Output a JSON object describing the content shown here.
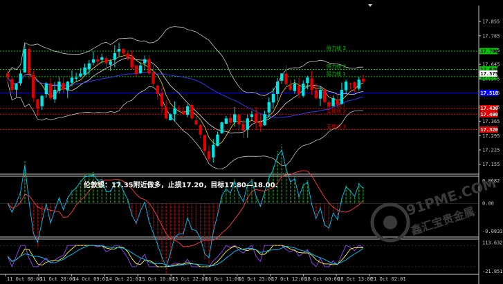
{
  "panels": {
    "main": {
      "ylim": [
        17.12,
        17.92
      ],
      "price_labels": [
        "17.855",
        "17.785",
        "17.715",
        "17.645",
        "17.575",
        "17.505",
        "17.435",
        "17.365",
        "17.295",
        "17.225",
        "17.155"
      ]
    },
    "macd": {
      "ylim": [
        -0.095,
        0.075
      ],
      "labels": [
        "0.0682",
        "0.00",
        "-0.0833"
      ]
    },
    "osc": {
      "ylim": [
        -26,
        120
      ],
      "labels": [
        "113.6327",
        "-21.8519"
      ]
    }
  },
  "time_labels": [
    "11 Oct 08:00",
    "11 Oct 20:00",
    "14 Oct 09:01",
    "14 Oct 21:01",
    "15 Oct 10:00",
    "15 Oct 22:00",
    "16 Oct 11:00",
    "16 Oct 23:00",
    "17 Oct 12:00",
    "18 Oct 00:00",
    "18 Oct 13:00",
    "21 Oct 02:01"
  ],
  "levels": [
    {
      "label": "阻力线 3",
      "price": 17.71,
      "color": "#00c800",
      "tag": "17.700",
      "tag_bg": "#00c800",
      "tag_fg": "#000000"
    },
    {
      "label": "阻力线 2",
      "price": 17.62,
      "color": "#00c800",
      "tag": "17.620",
      "tag_bg": "#00c800",
      "tag_fg": "#000000"
    },
    {
      "label": "阻力线 1",
      "price": 17.585,
      "color": "#00c800",
      "tag": "17.570",
      "tag_bg": "#00c800",
      "tag_fg": "#000000"
    },
    {
      "label": "支撑线 1",
      "price": 17.43,
      "color": "#e00000",
      "tag": "17.430",
      "tag_bg": "#e00000",
      "tag_fg": "#ffffff"
    },
    {
      "label": "支撑线 2",
      "price": 17.4,
      "color": "#e00000",
      "tag": "17.400",
      "tag_bg": "#e00000",
      "tag_fg": "#ffffff"
    },
    {
      "label": "支撑线 3",
      "price": 17.325,
      "color": "#e00000",
      "tag": "17.320",
      "tag_bg": "#e00000",
      "tag_fg": "#ffffff"
    }
  ],
  "blue_level": {
    "price": 17.505,
    "tag": "17.510",
    "tag_bg": "#0000ff",
    "tag_fg": "#ffffff",
    "color": "#0000ff"
  },
  "current_price": {
    "tag": "17.575",
    "tag_bg": "#ffffff",
    "tag_fg": "#000000"
  },
  "annotation": "伦敦银：17.35附近做多，止损17.20，目标17.80—18.00.",
  "watermark": {
    "text_top": "91PME.COM",
    "text_bottom": "鑫汇宝贵金属"
  },
  "colors": {
    "bull_candle": "#00e6e6",
    "bear_candle": "#e00000",
    "bands": "#c8c8c8",
    "ma_fast": "#ffd21e",
    "ma_mid": "#e0e0e0",
    "ma_slow": "#3c3cff",
    "macd_pos": "#00c800",
    "macd_neg": "#e00000",
    "signal_line": "#ff4040",
    "macd_line": "#00c8ff",
    "osc_1": "#ffff40",
    "osc_2": "#9a46ff",
    "osc_3": "#00c8ff",
    "grid": "#ffffff"
  },
  "chart_data": {
    "type": "candlestick",
    "close": [
      17.58,
      17.52,
      17.55,
      17.6,
      17.72,
      17.6,
      17.48,
      17.43,
      17.49,
      17.55,
      17.48,
      17.52,
      17.56,
      17.52,
      17.56,
      17.58,
      17.58,
      17.6,
      17.63,
      17.65,
      17.67,
      17.66,
      17.68,
      17.65,
      17.66,
      17.7,
      17.72,
      17.7,
      17.68,
      17.63,
      17.6,
      17.64,
      17.67,
      17.6,
      17.55,
      17.5,
      17.44,
      17.38,
      17.4,
      17.43,
      17.42,
      17.4,
      17.44,
      17.38,
      17.35,
      17.3,
      17.22,
      17.18,
      17.25,
      17.3,
      17.36,
      17.38,
      17.36,
      17.4,
      17.35,
      17.32,
      17.38,
      17.4,
      17.36,
      17.34,
      17.4,
      17.46,
      17.5,
      17.56,
      17.6,
      17.55,
      17.52,
      17.55,
      17.5,
      17.55,
      17.58,
      17.52,
      17.48,
      17.52,
      17.46,
      17.44,
      17.48,
      17.45,
      17.52,
      17.56,
      17.55,
      17.53,
      17.57,
      17.56
    ],
    "ylim": [
      17.12,
      17.92
    ]
  }
}
